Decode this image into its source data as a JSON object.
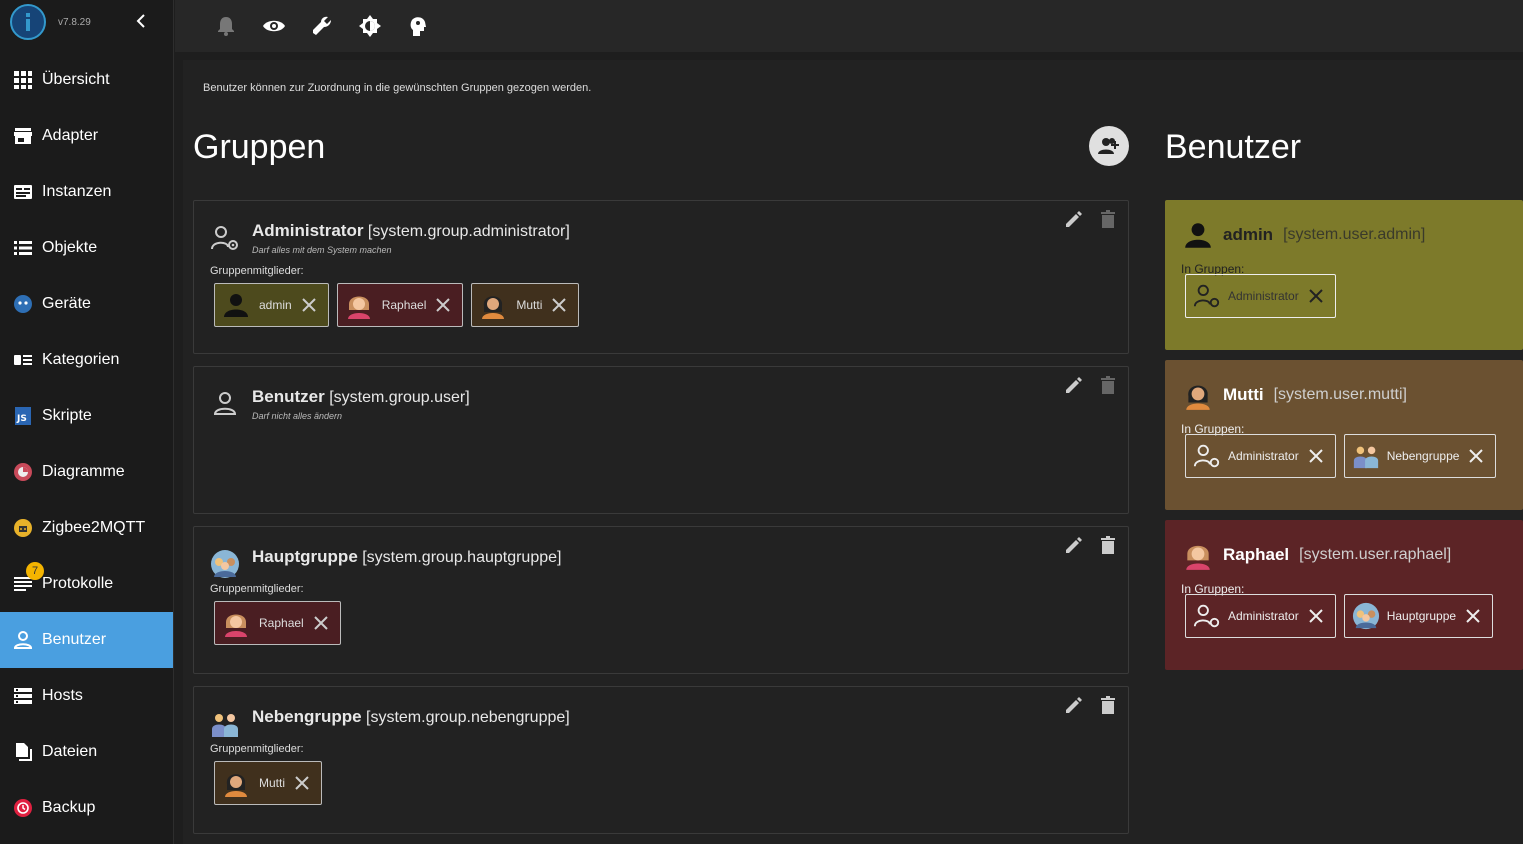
{
  "app": {
    "version": "v7.8.29"
  },
  "sidebar": {
    "items": [
      {
        "label": "Übersicht",
        "icon": "grid-icon"
      },
      {
        "label": "Adapter",
        "icon": "store-icon"
      },
      {
        "label": "Instanzen",
        "icon": "instances-icon"
      },
      {
        "label": "Objekte",
        "icon": "list-icon"
      },
      {
        "label": "Geräte",
        "icon": "devices-icon"
      },
      {
        "label": "Kategorien",
        "icon": "categories-icon"
      },
      {
        "label": "Skripte",
        "icon": "js-icon"
      },
      {
        "label": "Diagramme",
        "icon": "chart-icon"
      },
      {
        "label": "Zigbee2MQTT",
        "icon": "zigbee-icon"
      },
      {
        "label": "Protokolle",
        "icon": "log-icon",
        "badge": "7"
      },
      {
        "label": "Benutzer",
        "icon": "user-icon",
        "active": true
      },
      {
        "label": "Hosts",
        "icon": "hosts-icon"
      },
      {
        "label": "Dateien",
        "icon": "files-icon"
      },
      {
        "label": "Backup",
        "icon": "backup-icon"
      }
    ]
  },
  "toolbar": {
    "icons": [
      "bell-icon",
      "eye-icon",
      "wrench-icon",
      "brightness-icon",
      "expert-icon"
    ]
  },
  "main": {
    "hint": "Benutzer können zur Zuordnung in die gewünschten Gruppen gezogen werden.",
    "groups_title": "Gruppen",
    "users_title": "Benutzer",
    "members_label": "Gruppenmitglieder:",
    "in_groups_label": "In Gruppen:"
  },
  "groups": [
    {
      "name": "Administrator",
      "id": "[system.group.administrator]",
      "desc": "Darf alles mit dem System machen",
      "members": [
        "admin",
        "Raphael",
        "Mutti"
      ]
    },
    {
      "name": "Benutzer",
      "id": "[system.group.user]",
      "desc": "Darf nicht alles ändern",
      "members": []
    },
    {
      "name": "Hauptgruppe",
      "id": "[system.group.hauptgruppe]",
      "desc": "",
      "members": [
        "Raphael"
      ]
    },
    {
      "name": "Nebengruppe",
      "id": "[system.group.nebengruppe]",
      "desc": "",
      "members": [
        "Mutti"
      ]
    }
  ],
  "users": [
    {
      "name": "admin",
      "id": "[system.user.admin]",
      "color": "#7d7a2a",
      "groups": [
        "Administrator"
      ]
    },
    {
      "name": "Mutti",
      "id": "[system.user.mutti]",
      "color": "#6b5131",
      "groups": [
        "Administrator",
        "Nebengruppe"
      ]
    },
    {
      "name": "Raphael",
      "id": "[system.user.raphael]",
      "color": "#5c2426",
      "groups": [
        "Administrator",
        "Hauptgruppe"
      ]
    }
  ]
}
